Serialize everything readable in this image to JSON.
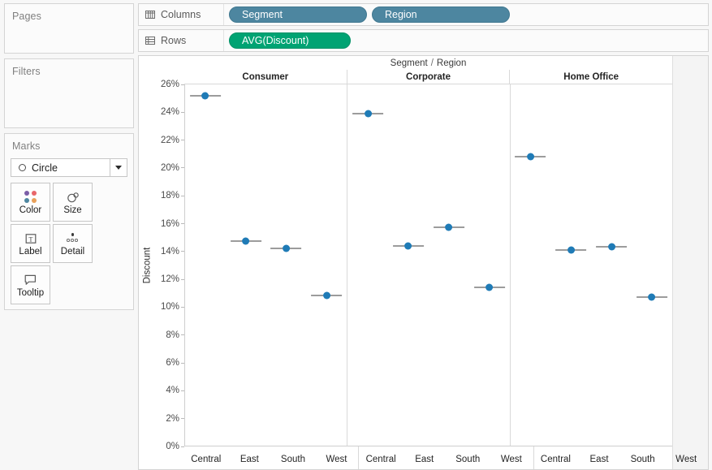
{
  "left_panel": {
    "pages": {
      "title": "Pages"
    },
    "filters": {
      "title": "Filters"
    },
    "marks": {
      "title": "Marks",
      "mark_type": "Circle",
      "buttons": [
        {
          "label": "Color",
          "icon": "color-dots-icon"
        },
        {
          "label": "Size",
          "icon": "size-icon"
        },
        {
          "label": "Label",
          "icon": "label-icon"
        },
        {
          "label": "Detail",
          "icon": "detail-icon"
        },
        {
          "label": "Tooltip",
          "icon": "tooltip-icon"
        }
      ],
      "color_dots": [
        "#7b5ea7",
        "#e8666a",
        "#4d86a0",
        "#e8a05a"
      ]
    }
  },
  "shelves": {
    "columns": {
      "label": "Columns",
      "pills": [
        {
          "text": "Segment",
          "kind": "dimension"
        },
        {
          "text": "Region",
          "kind": "dimension"
        }
      ]
    },
    "rows": {
      "label": "Rows",
      "pills": [
        {
          "text": "AVG(Discount)",
          "kind": "measure"
        }
      ]
    }
  },
  "colors": {
    "dimension_pill": "#4d86a0",
    "measure_pill": "#00a373",
    "mark": "#1f7bb6",
    "reference_line": "#3a3a3a"
  },
  "chart_data": {
    "type": "scatter",
    "title": "Segment / Region",
    "column_title_parts": {
      "left": "Segment",
      "sep": "/",
      "right": "Region"
    },
    "xlabel": "",
    "ylabel": "Discount",
    "ylim": [
      0,
      0.26
    ],
    "ytick_labels": [
      "26%",
      "24%",
      "22%",
      "20%",
      "18%",
      "16%",
      "14%",
      "12%",
      "10%",
      "8%",
      "6%",
      "4%",
      "2%",
      "0%"
    ],
    "ytick_values": [
      0.26,
      0.24,
      0.22,
      0.2,
      0.18,
      0.16,
      0.14,
      0.12,
      0.1,
      0.08,
      0.06,
      0.04,
      0.02,
      0.0
    ],
    "grid": false,
    "legend": "none",
    "categories": [
      "Central",
      "East",
      "South",
      "West"
    ],
    "panes": [
      {
        "name": "Consumer",
        "values": [
          0.252,
          0.147,
          0.142,
          0.108
        ]
      },
      {
        "name": "Corporate",
        "values": [
          0.239,
          0.144,
          0.157,
          0.114
        ]
      },
      {
        "name": "Home Office",
        "values": [
          0.208,
          0.141,
          0.143,
          0.107
        ]
      }
    ]
  }
}
